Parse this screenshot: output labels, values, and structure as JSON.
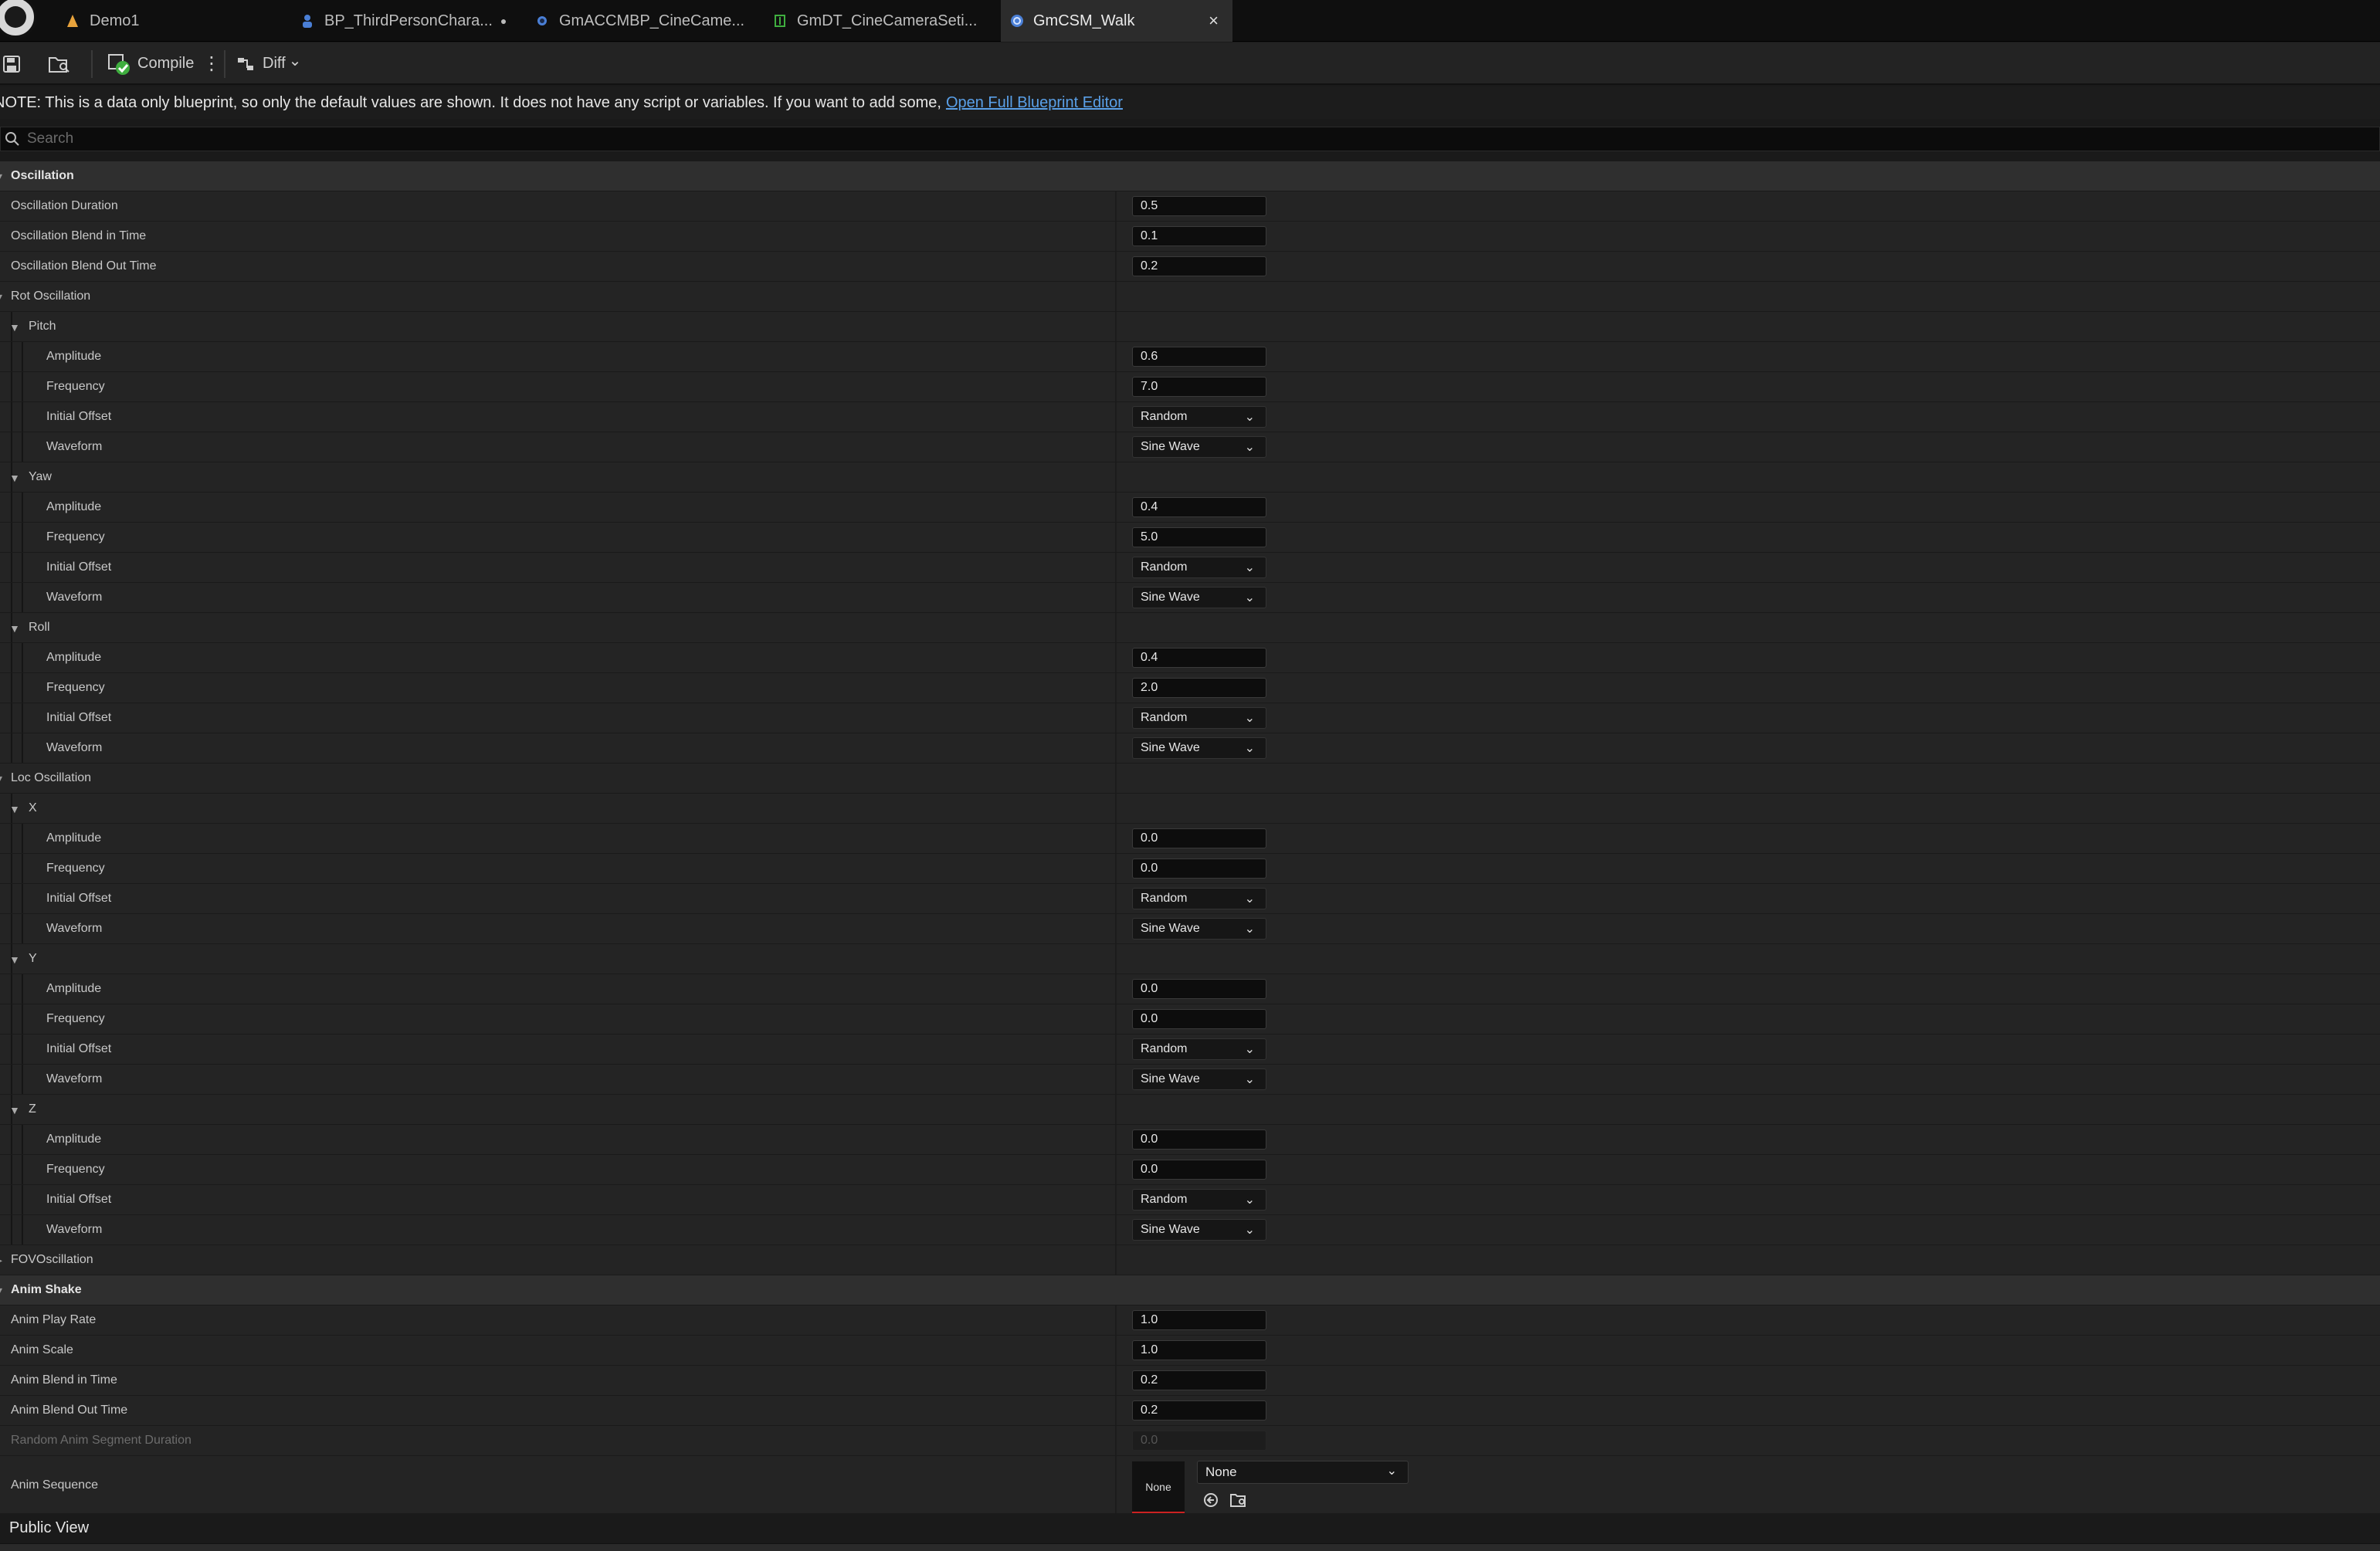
{
  "tabs": [
    {
      "label": "Demo1",
      "icon": "level-icon",
      "color": "#e8a33c"
    },
    {
      "label": "BP_ThirdPersonChara...",
      "icon": "character-blueprint-icon",
      "color": "#4a7fd6",
      "dirty": "●"
    },
    {
      "label": "GmACCMBP_CineCame...",
      "icon": "blueprint-icon",
      "color": "#4a7fd6"
    },
    {
      "label": "GmDT_CineCameraSeti...",
      "icon": "data-table-icon",
      "color": "#3fae3f"
    },
    {
      "label": "GmCSM_Walk",
      "icon": "camera-shake-icon",
      "color": "#4a7fd6",
      "close": "×"
    }
  ],
  "toolbar": {
    "compile_label": "Compile",
    "menu_glyph": "⋮",
    "diff_label": "Diff",
    "diff_chevron": "⌄"
  },
  "note": {
    "text": "NOTE: This is a data only blueprint, so only the default values are shown.  It does not have any script or variables.  If you want to add some,",
    "link": "Open Full Blueprint Editor"
  },
  "search": {
    "placeholder": "Search"
  },
  "details": {
    "oscillation_category": "Oscillation",
    "oscillation_duration": {
      "label": "Oscillation Duration",
      "value": "0.5"
    },
    "oscillation_blend_in": {
      "label": "Oscillation Blend in Time",
      "value": "0.1"
    },
    "oscillation_blend_out": {
      "label": "Oscillation Blend Out Time",
      "value": "0.2"
    },
    "rot_oscillation": "Rot Oscillation",
    "rot_groups": [
      {
        "name": "Pitch",
        "amplitude": "0.6",
        "frequency": "7.0",
        "initial_offset": "Random",
        "waveform": "Sine Wave"
      },
      {
        "name": "Yaw",
        "amplitude": "0.4",
        "frequency": "5.0",
        "initial_offset": "Random",
        "waveform": "Sine Wave"
      },
      {
        "name": "Roll",
        "amplitude": "0.4",
        "frequency": "2.0",
        "initial_offset": "Random",
        "waveform": "Sine Wave"
      }
    ],
    "loc_oscillation": "Loc Oscillation",
    "loc_groups": [
      {
        "name": "X",
        "amplitude": "0.0",
        "frequency": "0.0",
        "initial_offset": "Random",
        "waveform": "Sine Wave"
      },
      {
        "name": "Y",
        "amplitude": "0.0",
        "frequency": "0.0",
        "initial_offset": "Random",
        "waveform": "Sine Wave"
      },
      {
        "name": "Z",
        "amplitude": "0.0",
        "frequency": "0.0",
        "initial_offset": "Random",
        "waveform": "Sine Wave"
      }
    ],
    "field_labels": {
      "amplitude": "Amplitude",
      "frequency": "Frequency",
      "initial_offset": "Initial Offset",
      "waveform": "Waveform"
    },
    "fov_oscillation": "FOVOscillation",
    "anim_category": "Anim Shake",
    "anim_play_rate": {
      "label": "Anim Play Rate",
      "value": "1.0"
    },
    "anim_scale": {
      "label": "Anim Scale",
      "value": "1.0"
    },
    "anim_blend_in": {
      "label": "Anim Blend in Time",
      "value": "0.2"
    },
    "anim_blend_out": {
      "label": "Anim Blend Out Time",
      "value": "0.2"
    },
    "random_anim_segment": {
      "label": "Random Anim Segment Duration",
      "value": "0.0"
    },
    "anim_sequence": {
      "label": "Anim Sequence",
      "thumb": "None",
      "value": "None"
    }
  },
  "public_view": "Public View",
  "chevron_glyph": "⌄",
  "expand_glyph": "▼",
  "colors": {
    "accent_link": "#5aa0e8",
    "thumb_underline": "#c22222"
  }
}
